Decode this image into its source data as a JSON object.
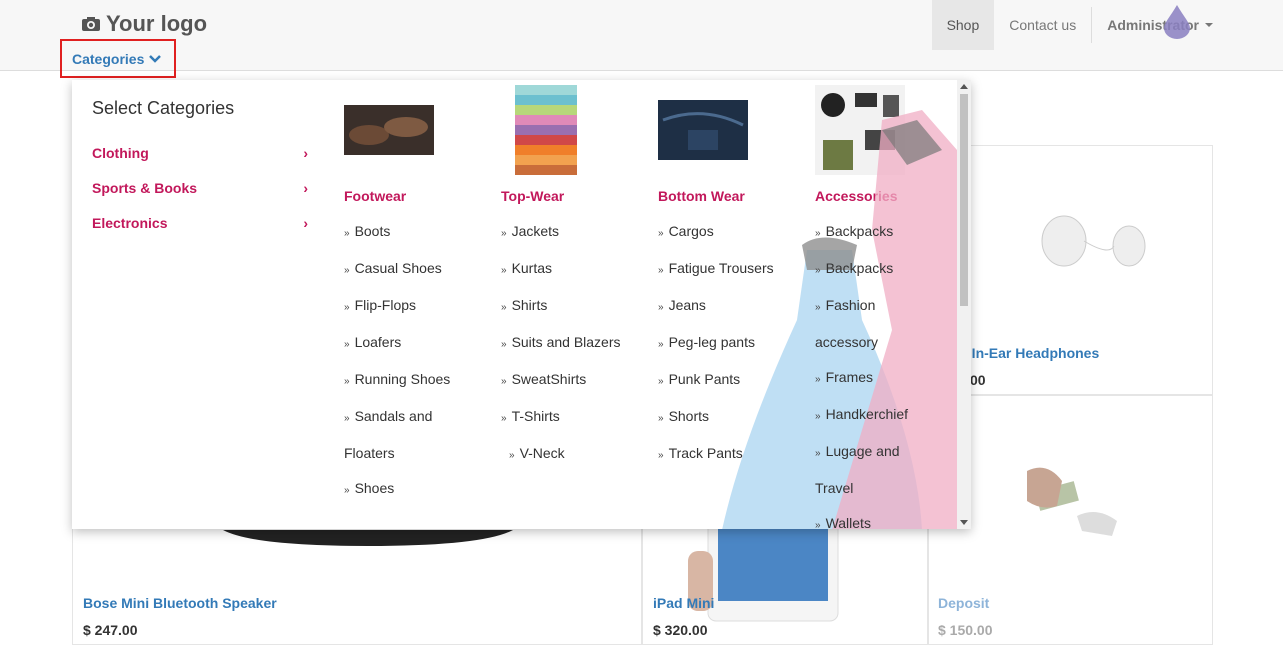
{
  "header": {
    "logo_text": "Your logo",
    "categories_label": "Categories",
    "nav": {
      "shop": "Shop",
      "contact": "Contact us",
      "admin": "Administrator"
    }
  },
  "products": [
    {
      "title": "Bose Mini Bluetooth Speaker",
      "price": "$ 247.00"
    },
    {
      "title": "iPad Mini",
      "price": "$ 320.00"
    },
    {
      "title": "Deposit",
      "price": "$ 150.00"
    },
    {
      "title": "Apple In-Ear Headphones",
      "title_visible": "e In-Ear Headphones",
      "price_visible": "00"
    }
  ],
  "menu": {
    "heading": "Select Categories",
    "categories": [
      "Clothing",
      "Sports & Books",
      "Electronics"
    ],
    "columns": [
      {
        "title": "Footwear",
        "items": [
          "Boots",
          "Casual Shoes",
          "Flip-Flops",
          "Loafers",
          "Running Shoes",
          "Sandals and",
          "Floaters",
          "Shoes"
        ]
      },
      {
        "title": "Top-Wear",
        "items": [
          "Jackets",
          "Kurtas",
          "Shirts",
          "Suits and Blazers",
          "SweatShirts",
          "T-Shirts",
          "V-Neck"
        ]
      },
      {
        "title": "Bottom Wear",
        "items": [
          "Cargos",
          "Fatigue Trousers",
          "Jeans",
          "Peg-leg pants",
          "Punk Pants",
          "Shorts",
          "Track Pants"
        ]
      },
      {
        "title": "Accessories",
        "items": [
          "Backpacks",
          "Backpacks",
          "Fashion",
          "accessory",
          "Frames",
          "Handkerchief",
          "Lugage and",
          "Travel",
          "Wallets"
        ]
      }
    ]
  },
  "colors": {
    "category": "#c2185b",
    "link": "#337ab7",
    "highlight_border": "#e02020"
  }
}
